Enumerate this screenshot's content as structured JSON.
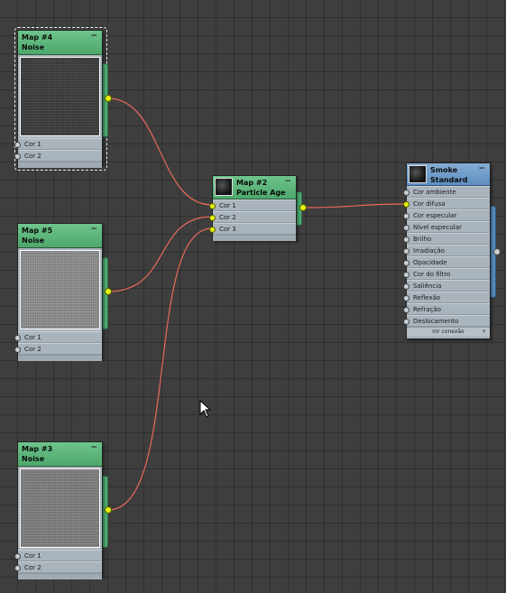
{
  "nodes": {
    "map4": {
      "title": "Map #4",
      "type": "Noise",
      "inputs": [
        "Cor 1",
        "Cor 2"
      ],
      "selected": true
    },
    "map5": {
      "title": "Map #5",
      "type": "Noise",
      "inputs": [
        "Cor 1",
        "Cor 2"
      ]
    },
    "map3": {
      "title": "Map #3",
      "type": "Noise",
      "inputs": [
        "Cor 1",
        "Cor 2"
      ]
    },
    "map2": {
      "title": "Map #2",
      "type": "Particle Age",
      "inputs": [
        "Cor 1",
        "Cor 2",
        "Cor 3"
      ]
    },
    "smoke": {
      "title": "Smoke",
      "type": "Standard",
      "inputs": [
        "Cor ambiente",
        "Cor difusa",
        "Cor especular",
        "Nível especular",
        "Brilho",
        "Irradiação",
        "Opacidade",
        "Cor do filtro",
        "Saliência",
        "Reflexão",
        "Refração",
        "Deslocamento"
      ],
      "footer": "mr conexão"
    }
  },
  "colors": {
    "wire": "#e86a5a",
    "socket_active": "#e6f20e",
    "map_header": "#5cb67c",
    "material_header": "#6b9ccc",
    "canvas": "#3e3e3e"
  },
  "icons": {
    "minimize": "−",
    "cursor": "arrow-cursor-icon"
  }
}
